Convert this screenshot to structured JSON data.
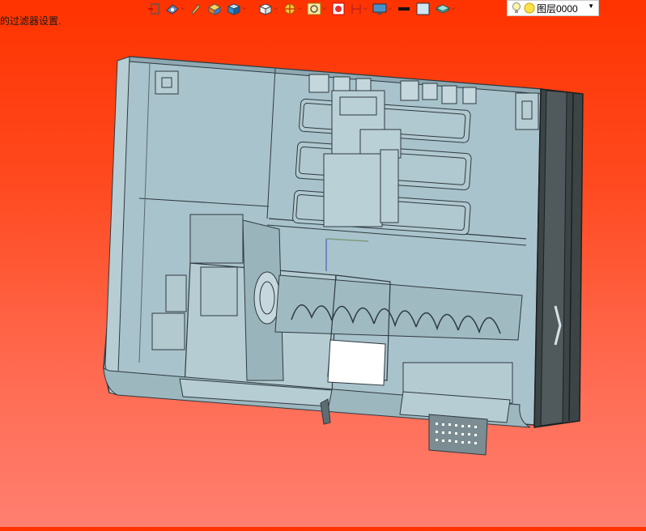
{
  "status_text": "的过滤器设置.",
  "toolbar": {
    "items": [
      {
        "name": "select-frame-icon",
        "dropdown": false
      },
      {
        "name": "view-orient-icon",
        "dropdown": true
      },
      {
        "name": "pencil-tool-icon",
        "dropdown": false
      },
      {
        "name": "box-view-icon",
        "dropdown": false
      },
      {
        "name": "display-style-icon",
        "dropdown": true
      },
      {
        "name": "cube-white-icon",
        "dropdown": true
      },
      {
        "name": "section-view-icon",
        "dropdown": true
      },
      {
        "name": "zoom-fit-icon",
        "dropdown": true
      },
      {
        "name": "red-view-icon",
        "dropdown": false
      },
      {
        "name": "bracket-view-icon",
        "dropdown": true
      },
      {
        "name": "monitor-icon",
        "dropdown": true
      },
      {
        "name": "line-weight-icon",
        "dropdown": false
      },
      {
        "name": "color-swatch-icon",
        "dropdown": false
      },
      {
        "name": "layer-stack-icon",
        "dropdown": true
      }
    ]
  },
  "layer": {
    "current": "图层0000",
    "bulb_icon": "lightbulb-icon",
    "sun_icon": "sun-icon"
  },
  "colors": {
    "background_top": "#ff3300",
    "background_bottom": "#ff7f70",
    "model_fill": "#a9c3cc",
    "model_edge": "#2e3a40",
    "model_dark": "#3c4446"
  }
}
